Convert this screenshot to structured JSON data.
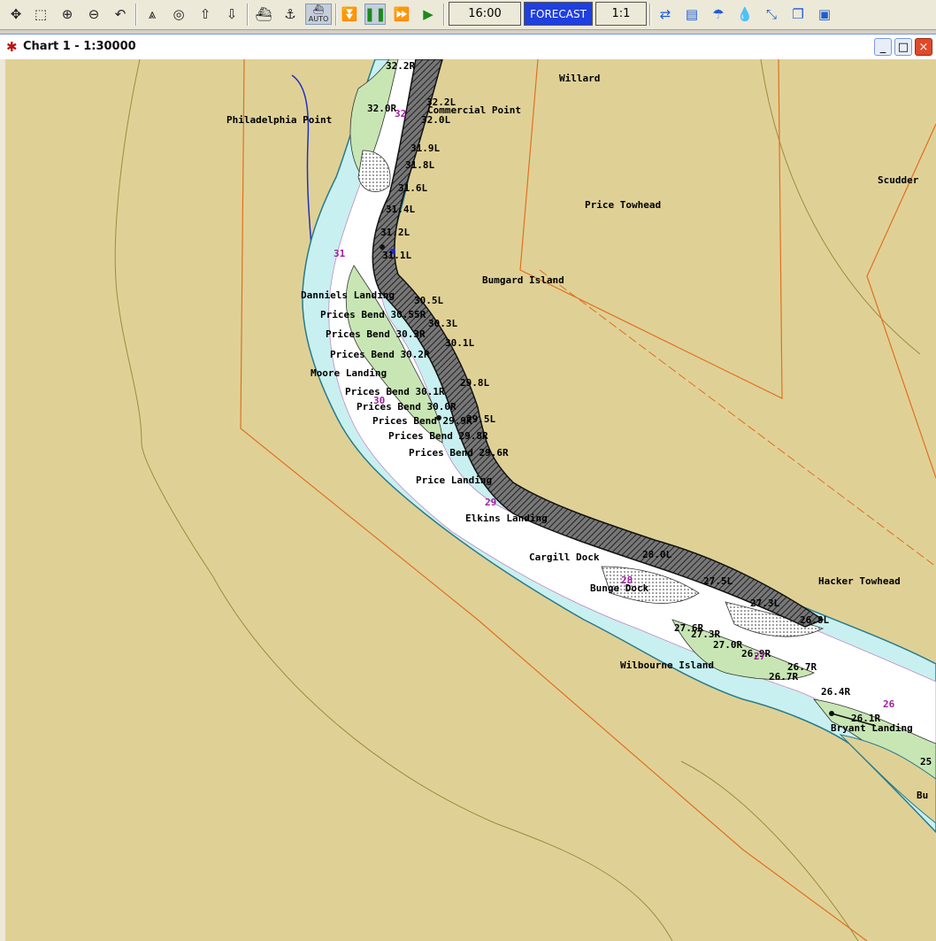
{
  "toolbar": {
    "auto_label": "AUTO",
    "time": "16:00",
    "forecast": "FORECAST",
    "scale": "1:1",
    "colors": {
      "forecast_bg": "#1f3fe0",
      "forecast_text": "#ffffff"
    }
  },
  "window": {
    "title": "Chart 1 - 1:30000",
    "minimize": "_",
    "maximize": "□",
    "close": "×"
  },
  "map": {
    "colors": {
      "land": "#dfd196",
      "channel": "#ffffff",
      "shallow": "#c8f0f0",
      "bar": "#c8e6b4",
      "bank": "#333333"
    },
    "place_labels": [
      {
        "name": "willard",
        "text": "Willard"
      },
      {
        "name": "philadelphia-point",
        "text": "Philadelphia Point"
      },
      {
        "name": "commercial-point",
        "text": "Commercial Point"
      },
      {
        "name": "scudder",
        "text": "Scudder"
      },
      {
        "name": "price-towhead",
        "text": "Price Towhead"
      },
      {
        "name": "bumgard-island",
        "text": "Bumgard Island"
      },
      {
        "name": "daniels-landing",
        "text": "Danniels Landing"
      },
      {
        "name": "prices-bend-1",
        "text": "Prices Bend 30.55R"
      },
      {
        "name": "prices-bend-2",
        "text": "Prices Bend 30.3R"
      },
      {
        "name": "prices-bend-3",
        "text": "Prices Bend 30.2R"
      },
      {
        "name": "moore-landing",
        "text": "Moore Landing"
      },
      {
        "name": "prices-bend-4",
        "text": "Prices Bend 30.1R"
      },
      {
        "name": "prices-bend-5",
        "text": "Prices Bend 30.0R"
      },
      {
        "name": "prices-bend-6",
        "text": "Prices Bend 29.9R"
      },
      {
        "name": "prices-bend-7",
        "text": "Prices Bend 29.8R"
      },
      {
        "name": "prices-bend-8",
        "text": "Prices Bend 29.6R"
      },
      {
        "name": "price-landing",
        "text": "Price Landing"
      },
      {
        "name": "elkins-landing",
        "text": "Elkins Landing"
      },
      {
        "name": "cargill-dock",
        "text": "Cargill Dock"
      },
      {
        "name": "bunge-dock",
        "text": "Bunge Dock"
      },
      {
        "name": "hacker-towhead",
        "text": "Hacker Towhead"
      },
      {
        "name": "wilbourne-island",
        "text": "Wilbourne Island"
      },
      {
        "name": "bryant-landing",
        "text": "Bryant Landing"
      },
      {
        "name": "bu-partial",
        "text": "Bu"
      }
    ],
    "mile_markers": [
      "32.2R",
      "32.2L",
      "32.0R",
      "32.0L",
      "31.9L",
      "31.8L",
      "31.6L",
      "31.4L",
      "31.2L",
      "31.1L",
      "30.5L",
      "30.3L",
      "30.1L",
      "29.8L",
      "29.5L",
      "28.0L",
      "27.5L",
      "27.3L",
      "26.8L",
      "27.6R",
      "27.3R",
      "27.0R",
      "26.9R",
      "26.7R",
      "26.7R",
      "26.4R",
      "26.1R",
      "25"
    ],
    "mile_numbers": [
      "31",
      "32",
      "30",
      "29",
      "28",
      "27",
      "26"
    ]
  }
}
